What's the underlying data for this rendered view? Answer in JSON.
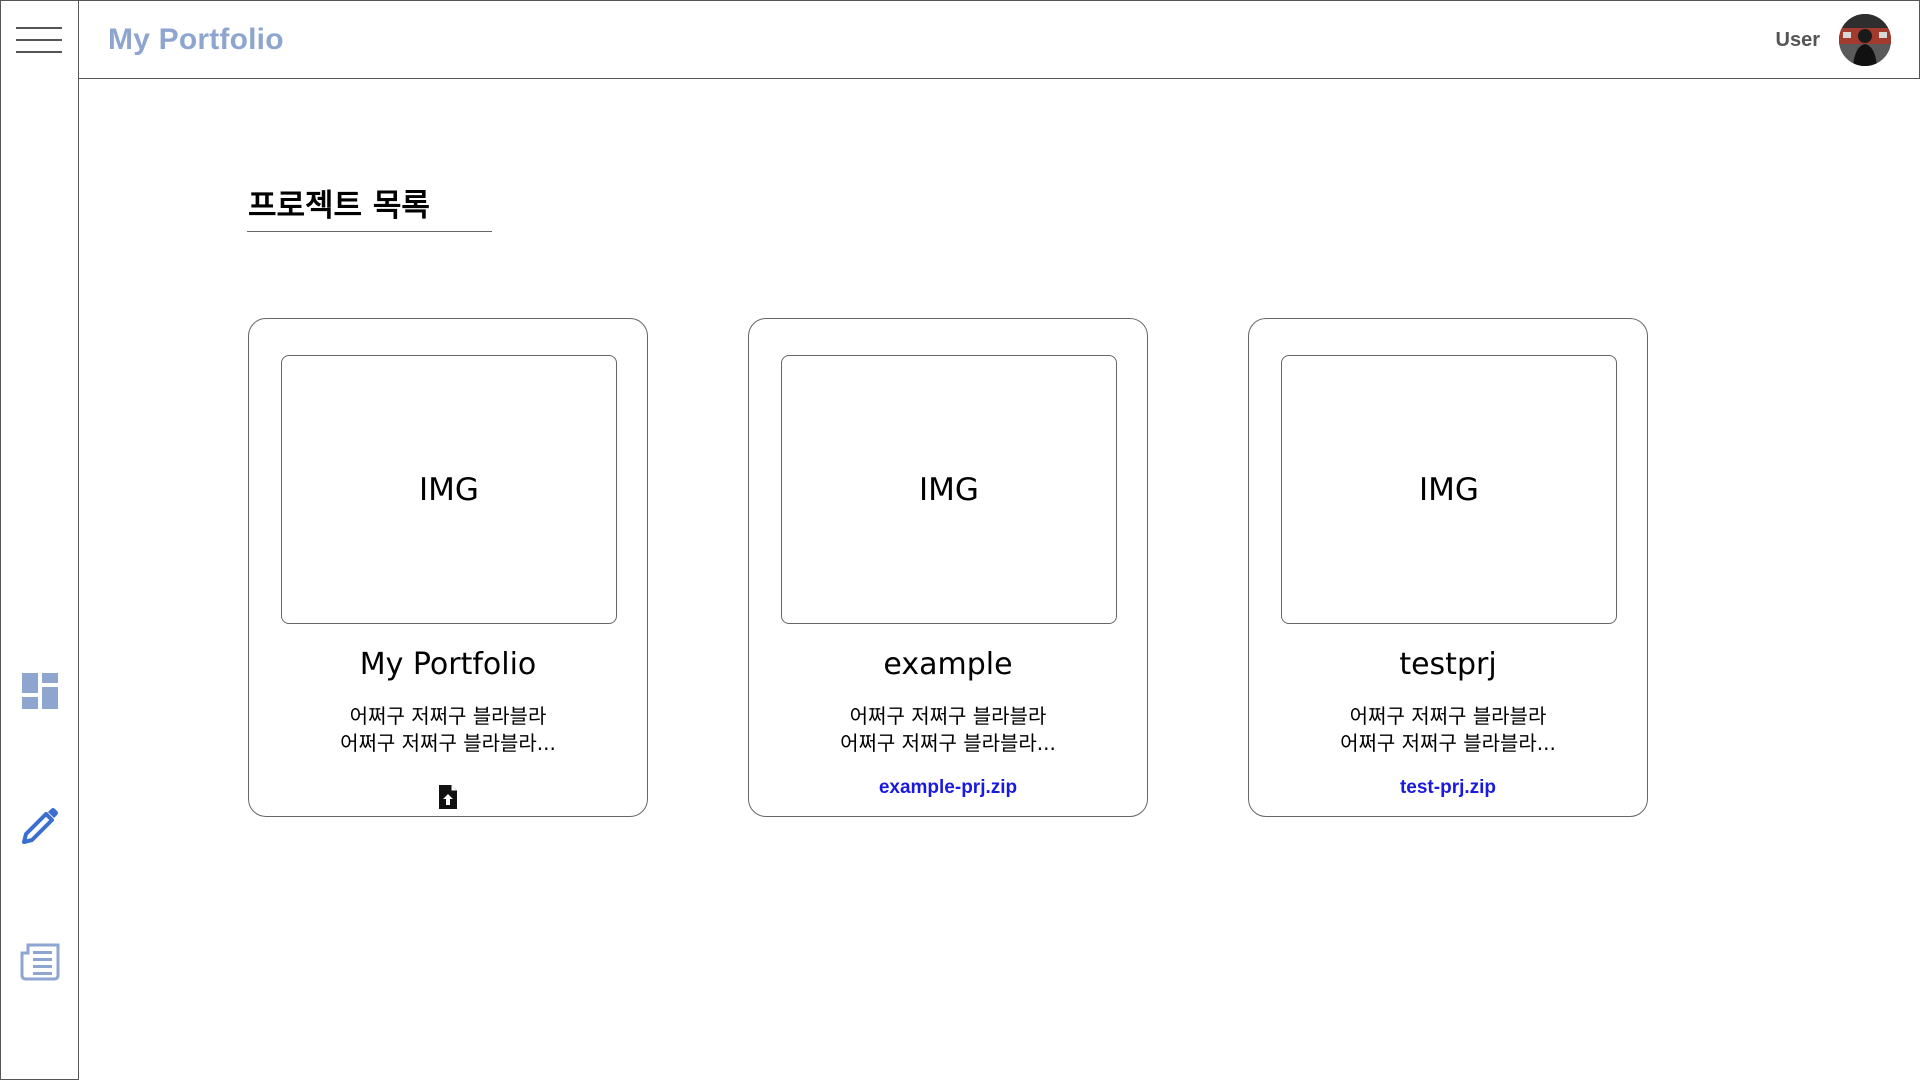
{
  "header": {
    "app_title": "My Portfolio",
    "user_label": "User"
  },
  "sidebar": {
    "items": [
      {
        "icon": "dashboard-icon"
      },
      {
        "icon": "pencil-icon"
      },
      {
        "icon": "document-list-icon"
      }
    ]
  },
  "main": {
    "section_title": "프로젝트 목록",
    "projects": [
      {
        "image_placeholder": "IMG",
        "title": "My Portfolio",
        "desc_line1": "어쩌구 저쩌구 블라블라",
        "desc_line2": "어쩌구 저쩌구 블라블라...",
        "attachment": null,
        "action_icon": "file-upload-icon"
      },
      {
        "image_placeholder": "IMG",
        "title": "example",
        "desc_line1": "어쩌구 저쩌구 블라블라",
        "desc_line2": "어쩌구 저쩌구 블라블라...",
        "attachment": "example-prj.zip"
      },
      {
        "image_placeholder": "IMG",
        "title": "testprj",
        "desc_line1": "어쩌구 저쩌구 블라블라",
        "desc_line2": "어쩌구 저쩌구 블라블라...",
        "attachment": "test-prj.zip"
      }
    ]
  },
  "colors": {
    "brand": "#8ea6cf",
    "sidebar_icon": "#8ea6cf",
    "edit_icon": "#3a6fd0",
    "link": "#1a1adf"
  }
}
